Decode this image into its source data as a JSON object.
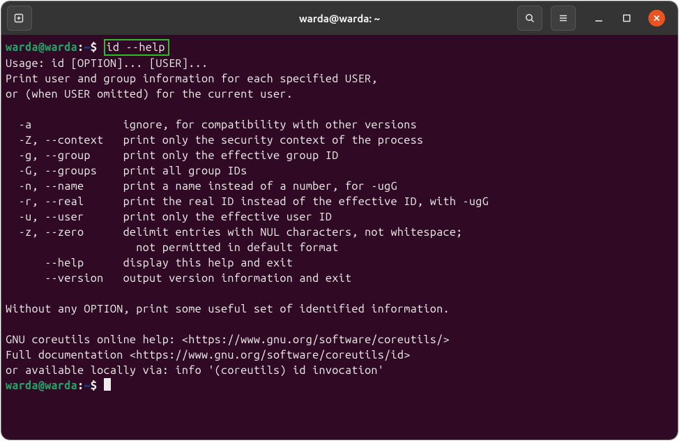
{
  "titlebar": {
    "title": "warda@warda: ~"
  },
  "colors": {
    "user": "#26a269",
    "path": "#12488b",
    "bg": "#300a24",
    "close": "#e95420"
  },
  "prompt1": {
    "user_host": "warda@warda",
    "colon": ":",
    "path": "~",
    "dollar": "$ ",
    "command": "id --help"
  },
  "output": {
    "line1": "Usage: id [OPTION]... [USER]...",
    "line2": "Print user and group information for each specified USER,",
    "line3": "or (when USER omitted) for the current user.",
    "blank1": "",
    "opt_a": "  -a              ignore, for compatibility with other versions",
    "opt_Z": "  -Z, --context   print only the security context of the process",
    "opt_g": "  -g, --group     print only the effective group ID",
    "opt_G": "  -G, --groups    print all group IDs",
    "opt_n": "  -n, --name      print a name instead of a number, for -ugG",
    "opt_r": "  -r, --real      print the real ID instead of the effective ID, with -ugG",
    "opt_u": "  -u, --user      print only the effective user ID",
    "opt_z": "  -z, --zero      delimit entries with NUL characters, not whitespace;",
    "opt_z2": "                    not permitted in default format",
    "opt_help": "      --help      display this help and exit",
    "opt_ver": "      --version   output version information and exit",
    "blank2": "",
    "without": "Without any OPTION, print some useful set of identified information.",
    "blank3": "",
    "online": "GNU coreutils online help: <https://www.gnu.org/software/coreutils/>",
    "fulldoc": "Full documentation <https://www.gnu.org/software/coreutils/id>",
    "local": "or available locally via: info '(coreutils) id invocation'"
  },
  "prompt2": {
    "user_host": "warda@warda",
    "colon": ":",
    "path": "~",
    "dollar": "$ "
  }
}
